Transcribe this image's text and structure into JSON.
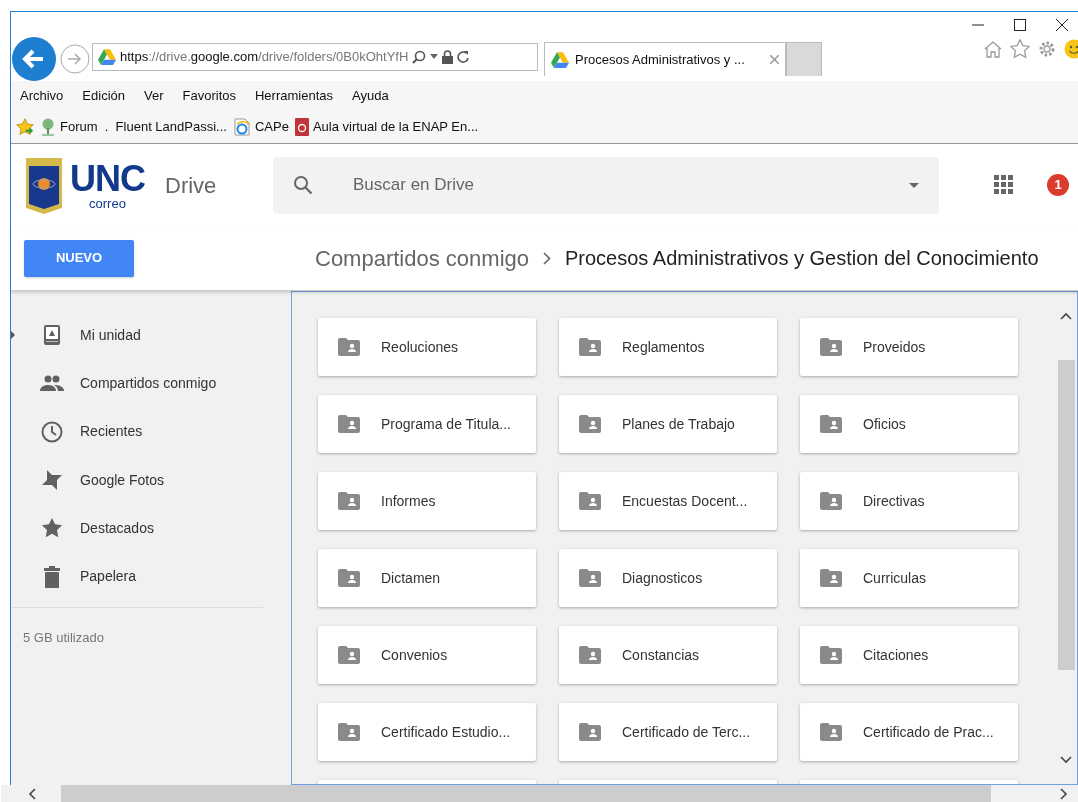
{
  "browser": {
    "address": {
      "host_prefix": "https://drive.",
      "host": "google.com",
      "path": "/drive/folders/0B0kOhtYfH"
    },
    "tabs": [
      {
        "label": "Procesos Administrativos y ...",
        "selected": true
      }
    ],
    "menu": [
      "Archivo",
      "Edición",
      "Ver",
      "Favoritos",
      "Herramientas",
      "Ayuda"
    ],
    "favorites": [
      {
        "label": "Forum  .  Fluent LandPassi...",
        "kind": "tree"
      },
      {
        "label": "CAPe",
        "kind": "ie"
      },
      {
        "label": "Aula virtual de la ENAP En...",
        "kind": "book"
      }
    ]
  },
  "header": {
    "logo": {
      "name": "UNC",
      "sub": "correo"
    },
    "product": "Drive",
    "search": {
      "placeholder": "Buscar en Drive"
    },
    "notifications": "1"
  },
  "new_button": "NUEVO",
  "breadcrumb": [
    {
      "label": "Compartidos conmigo",
      "selected": false
    },
    {
      "label": "Procesos Administrativos y Gestion del Conocimiento",
      "selected": true
    }
  ],
  "sidebar": {
    "items": [
      {
        "label": "Mi unidad",
        "kind": "drive",
        "expandable": true
      },
      {
        "label": "Compartidos conmigo",
        "kind": "people",
        "expandable": false
      },
      {
        "label": "Recientes",
        "kind": "clock",
        "expandable": false
      },
      {
        "label": "Google Fotos",
        "kind": "pinwheel",
        "expandable": false
      },
      {
        "label": "Destacados",
        "kind": "star",
        "expandable": false
      },
      {
        "label": "Papelera",
        "kind": "trash",
        "expandable": false
      }
    ],
    "storage": "5 GB utilizado"
  },
  "folders": [
    "Reoluciones",
    "Reglamentos",
    "Proveidos",
    "Programa de Titula...",
    "Planes de Trabajo",
    "Oficios",
    "Informes",
    "Encuestas Docent...",
    "Directivas",
    "Dictamen",
    "Diagnosticos",
    "Curriculas",
    "Convenios",
    "Constancias",
    "Citaciones",
    "Certificado Estudio...",
    "Certificado de Terc...",
    "Certificado de Prac..."
  ]
}
